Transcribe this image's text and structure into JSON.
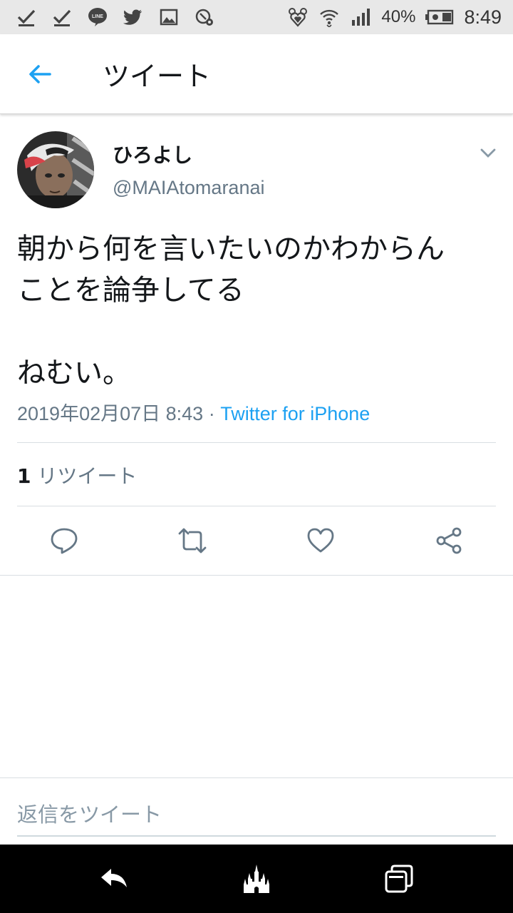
{
  "status_bar": {
    "icons_left": [
      "check-icon",
      "check-icon",
      "line-app-icon",
      "twitter-bird-icon",
      "image-icon",
      "settings-sync-icon"
    ],
    "icons_right": [
      "mickey-heart-icon",
      "wifi-icon",
      "signal-icon",
      "battery-icon"
    ],
    "line_label": "LINE",
    "battery_percent": "40%",
    "time": "8:49"
  },
  "header": {
    "title": "ツイート"
  },
  "tweet": {
    "display_name": "ひろよし",
    "handle": "@MAIAtomaranai",
    "text": "朝から何を言いたいのかわからん\nことを論争してる\n\nねむい。",
    "timestamp": "2019年02月07日 8:43",
    "separator": " · ",
    "source": "Twitter for iPhone",
    "retweet_count": "1",
    "retweet_label": " リツイート"
  },
  "actions": [
    "reply-icon",
    "retweet-icon",
    "like-icon",
    "share-icon"
  ],
  "reply": {
    "placeholder": "返信をツイート"
  },
  "nav_bar": {
    "buttons": [
      "back-nav-icon",
      "castle-home-icon",
      "recents-icon"
    ]
  },
  "colors": {
    "accent": "#1da1f2",
    "text_primary": "#14171a",
    "text_secondary": "#657786",
    "status_bar_bg": "#e8e8e8",
    "nav_bar_bg": "#000000"
  }
}
